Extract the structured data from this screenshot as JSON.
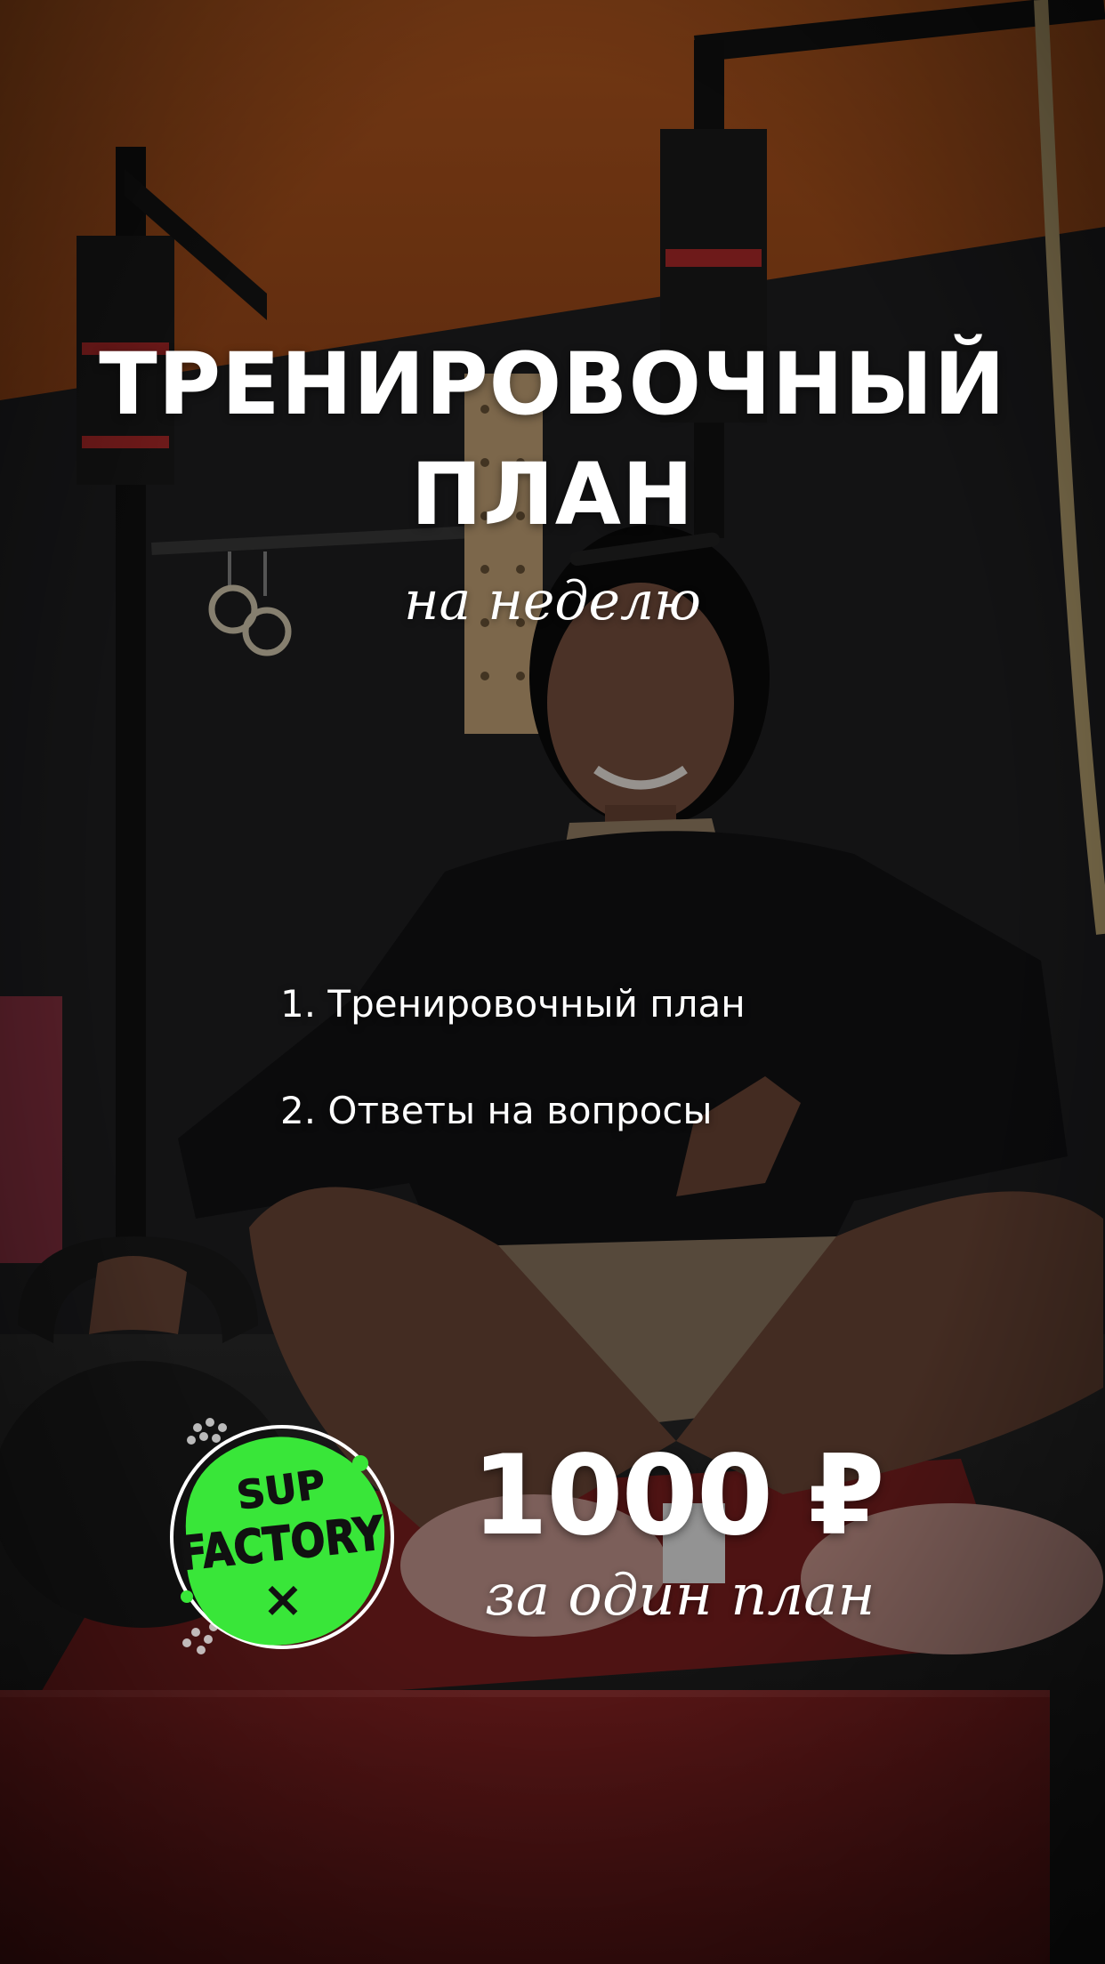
{
  "poster": {
    "title_line1": "ТРЕНИРОВОЧНЫЙ",
    "title_line2": "ПЛАН",
    "subtitle": "на неделю",
    "items": [
      "1. Тренировочный план",
      "2. Ответы на вопросы"
    ],
    "price": "1000 ₽",
    "price_note": "за один план"
  },
  "logo": {
    "line1": "SUP",
    "line2": "FACTORY",
    "mark": "×",
    "accent_color": "#39e639"
  },
  "colors": {
    "wall_orange": "#b5581f",
    "box_red": "#7a1e1e",
    "text": "#ffffff"
  }
}
